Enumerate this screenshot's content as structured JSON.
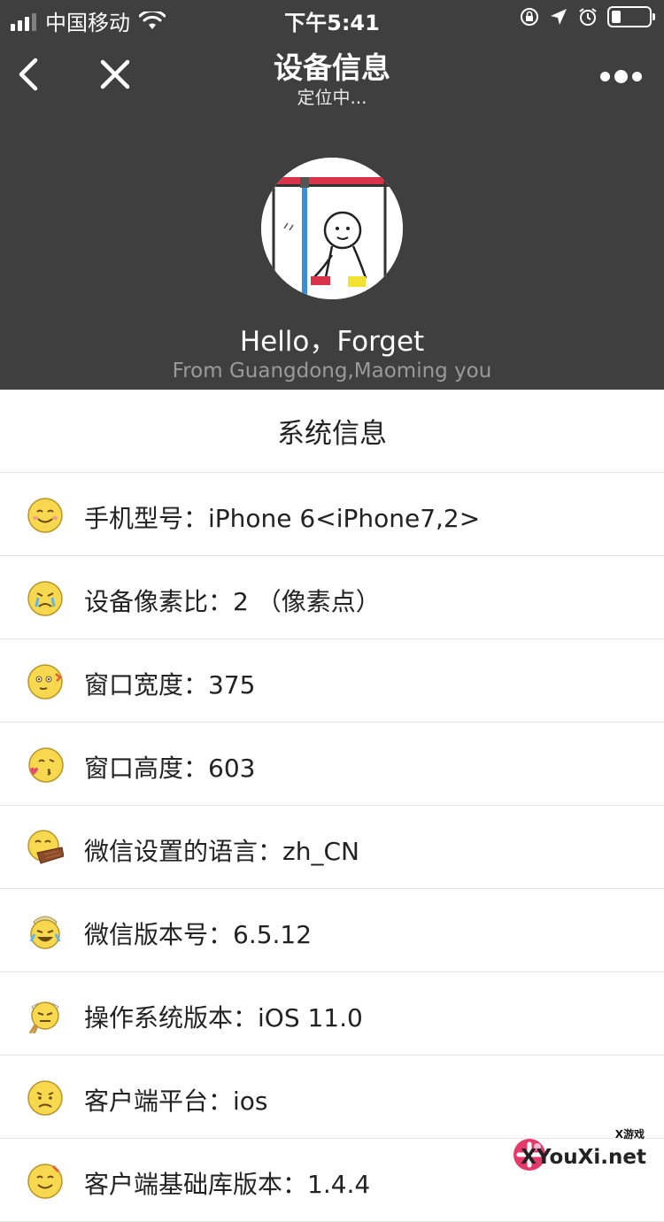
{
  "status_bar": {
    "carrier": "中国移动",
    "time": "下午5:41"
  },
  "nav": {
    "title": "设备信息",
    "subtitle": "定位中..."
  },
  "profile": {
    "greeting": "Hello，Forget",
    "location": "From Guangdong,Maoming you"
  },
  "section": {
    "title": "系统信息"
  },
  "rows": [
    {
      "label": "手机型号：iPhone 6<iPhone7,2>",
      "icon": "smile-emoji-icon"
    },
    {
      "label": "设备像素比：2 （像素点）",
      "icon": "cry-emoji-icon"
    },
    {
      "label": "窗口宽度：375",
      "icon": "shy-emoji-icon"
    },
    {
      "label": "窗口高度：603",
      "icon": "kiss-emoji-icon"
    },
    {
      "label": "微信设置的语言：zh_CN",
      "icon": "hide-emoji-icon"
    },
    {
      "label": "微信版本号：6.5.12",
      "icon": "laugh-cry-emoji-icon"
    },
    {
      "label": "操作系统版本：iOS 11.0",
      "icon": "struggle-emoji-icon"
    },
    {
      "label": "客户端平台：ios",
      "icon": "sad-emoji-icon"
    },
    {
      "label": "客户端基础库版本：1.4.4",
      "icon": "smile-emoji-icon"
    }
  ],
  "watermark": {
    "main": "XYouXi.net",
    "small": "X游戏"
  },
  "colors": {
    "header_bg": "#3f3f3f",
    "divider": "#e5e5e5",
    "emoji_yellow": "#f7d84f"
  }
}
